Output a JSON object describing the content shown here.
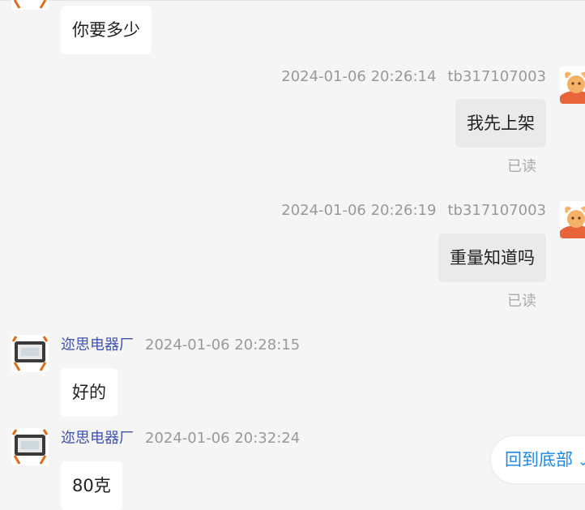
{
  "messages": [
    {
      "side": "left",
      "text": "你要多少"
    },
    {
      "side": "right",
      "time": "2024-01-06 20:26:14",
      "user": "tb317107003",
      "text": "我先上架",
      "status": "已读"
    },
    {
      "side": "right",
      "time": "2024-01-06 20:26:19",
      "user": "tb317107003",
      "text": "重量知道吗",
      "status": "已读"
    },
    {
      "side": "left",
      "sender": "迩思电器厂",
      "time": "2024-01-06 20:28:15",
      "text": "好的"
    },
    {
      "side": "left",
      "sender": "迩思电器厂",
      "time": "2024-01-06 20:32:24",
      "text": "80克"
    }
  ],
  "back_to_bottom": {
    "label": "回到底部",
    "icon": "chevron-down-icon"
  },
  "colors": {
    "background": "#f5f5f5",
    "left_bubble": "#ffffff",
    "right_bubble": "#eaeaea",
    "sender_name": "#3f51b5",
    "meta_text": "#999999",
    "link": "#1e88e5"
  }
}
